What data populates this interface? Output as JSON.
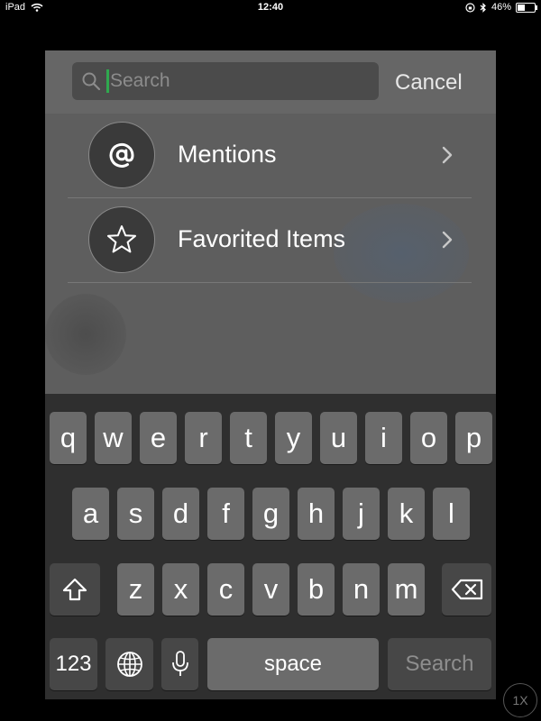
{
  "status_bar": {
    "device": "iPad",
    "time": "12:40",
    "battery": "46%",
    "battery_level": 0.46
  },
  "search": {
    "placeholder": "Search",
    "value": "",
    "cancel_label": "Cancel"
  },
  "shortcuts": [
    {
      "label": "Mentions",
      "icon": "at-icon"
    },
    {
      "label": "Favorited Items",
      "icon": "star-icon"
    }
  ],
  "keyboard": {
    "row1": [
      "q",
      "w",
      "e",
      "r",
      "t",
      "y",
      "u",
      "i",
      "o",
      "p"
    ],
    "row2": [
      "a",
      "s",
      "d",
      "f",
      "g",
      "h",
      "j",
      "k",
      "l"
    ],
    "row3": [
      "z",
      "x",
      "c",
      "v",
      "b",
      "n",
      "m"
    ],
    "numbers_label": "123",
    "space_label": "space",
    "search_label": "Search"
  },
  "zoom_label": "1X"
}
